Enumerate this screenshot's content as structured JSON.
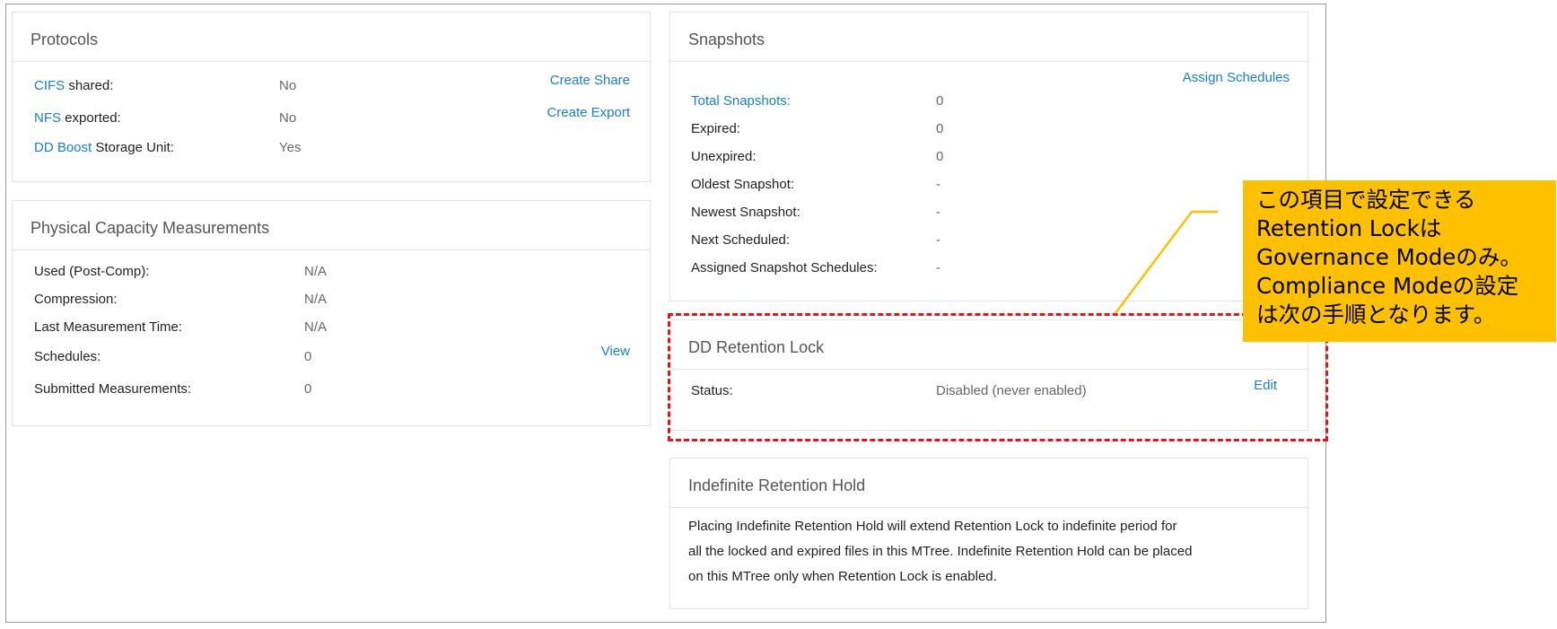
{
  "protocols": {
    "title": "Protocols",
    "rows": [
      {
        "link": "CIFS",
        "label": " shared:",
        "value": "No"
      },
      {
        "link": "NFS",
        "label": " exported:",
        "value": "No"
      },
      {
        "link": "DD Boost",
        "label": " Storage Unit:",
        "value": "Yes"
      }
    ],
    "create_share": "Create Share",
    "create_export": "Create Export"
  },
  "physical_capacity": {
    "title": "Physical Capacity Measurements",
    "rows": [
      {
        "label": "Used (Post-Comp):",
        "value": "N/A"
      },
      {
        "label": "Compression:",
        "value": "N/A"
      },
      {
        "label": "Last Measurement Time:",
        "value": "N/A"
      },
      {
        "label": "Schedules:",
        "value": "0"
      },
      {
        "label": "Submitted Measurements:",
        "value": "0"
      }
    ],
    "view_link": "View"
  },
  "snapshots": {
    "title": "Snapshots",
    "assign_schedules": "Assign Schedules",
    "total_label": "Total Snapshots:",
    "total_value": "0",
    "rows": [
      {
        "label": "Expired:",
        "value": "0"
      },
      {
        "label": "Unexpired:",
        "value": "0"
      },
      {
        "label": "Oldest Snapshot:",
        "value": "-"
      },
      {
        "label": "Newest Snapshot:",
        "value": "-"
      },
      {
        "label": "Next Scheduled:",
        "value": "-"
      },
      {
        "label": "Assigned Snapshot Schedules:",
        "value": "-"
      }
    ]
  },
  "retention_lock": {
    "title": "DD Retention Lock",
    "status_label": "Status:",
    "status_value": "Disabled (never enabled)",
    "edit_link": "Edit"
  },
  "indefinite_hold": {
    "title": "Indefinite Retention Hold",
    "lines": [
      "Placing Indefinite Retention Hold will extend Retention Lock to indefinite period for",
      "all the locked and expired files in this MTree. Indefinite Retention Hold can be placed",
      "on this MTree only when Retention Lock is enabled."
    ]
  },
  "callout": {
    "lines": [
      "この項目で設定できる",
      "Retention Lockは",
      "Governance Modeのみ。",
      "Compliance Modeの設定",
      "は次の手順となります。"
    ],
    "background_color": "#ffc000",
    "highlight_border_color": "#e8141b"
  }
}
